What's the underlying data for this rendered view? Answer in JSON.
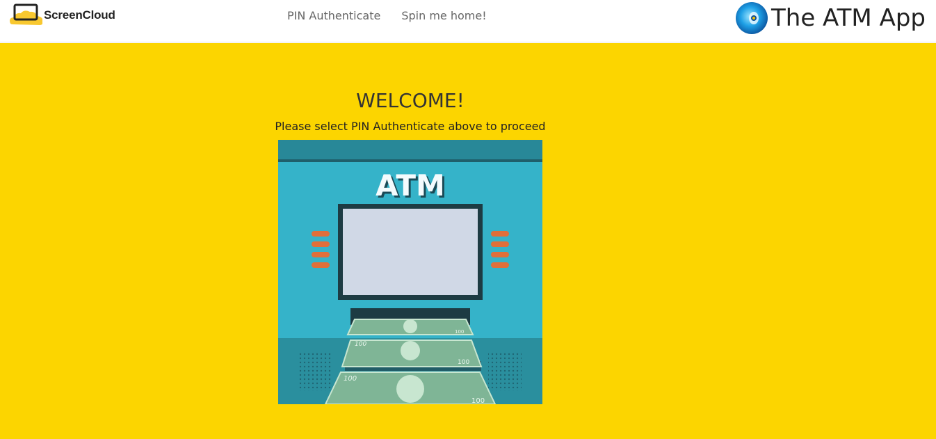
{
  "header": {
    "logo_text": "ScreenCloud",
    "nav": [
      {
        "label": "PIN Authenticate"
      },
      {
        "label": "Spin me home!"
      }
    ],
    "brand_text": "The ATM App"
  },
  "main": {
    "welcome": "WELCOME!",
    "subtitle": "Please select PIN Authenticate above to proceed",
    "atm_label": "ATM",
    "bill_value": "100"
  },
  "colors": {
    "page_background": "#fcd500",
    "atm_teal": "#35b3c9",
    "atm_dark": "#1d3b43",
    "screen": "#d0d8e6",
    "buttons": "#e06f3a",
    "money": "#7fb596"
  }
}
